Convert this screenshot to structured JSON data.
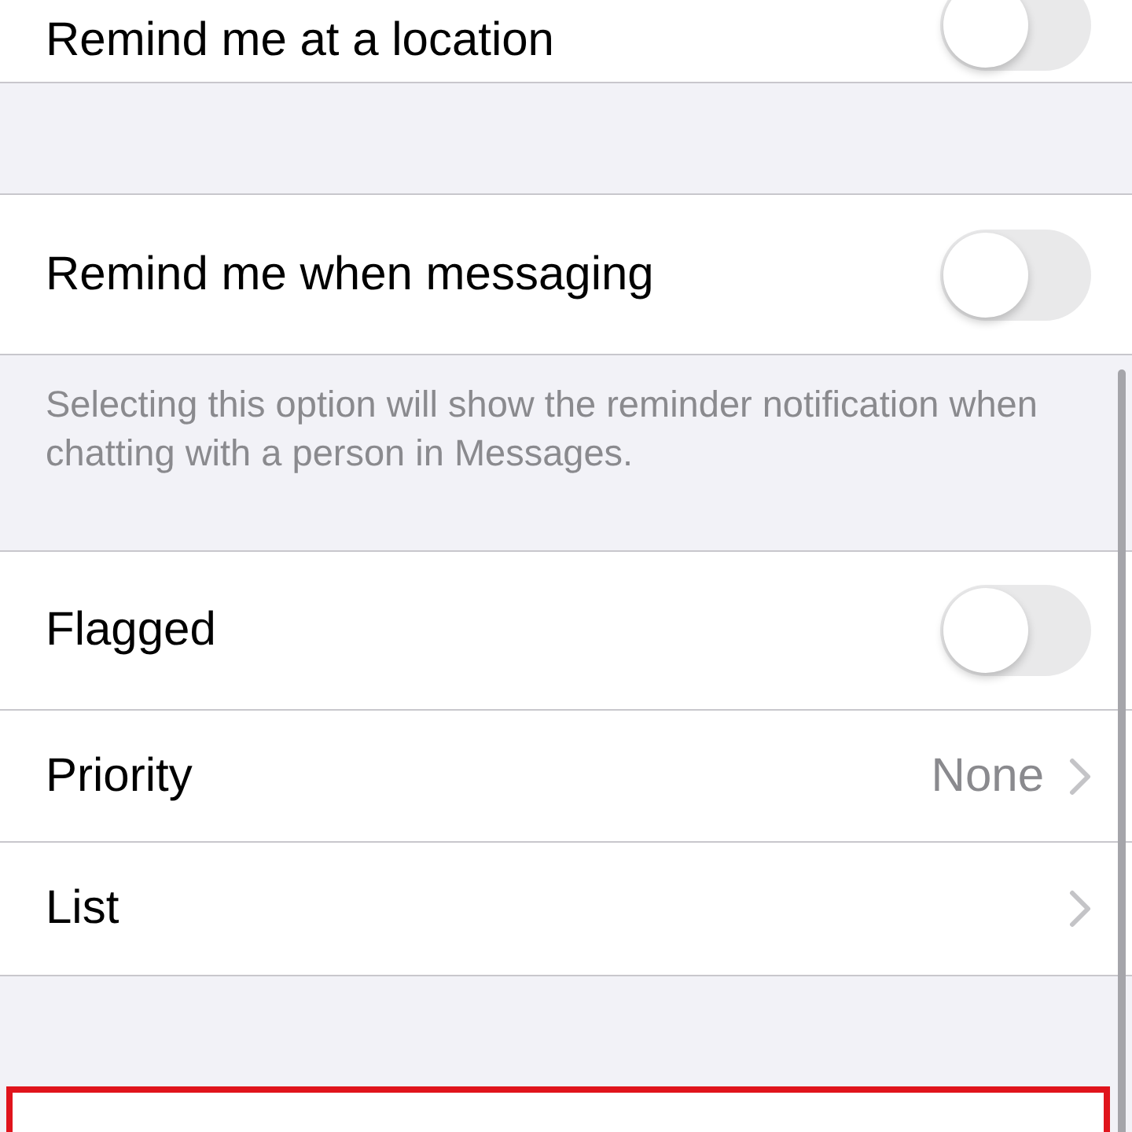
{
  "sections": [
    {
      "rows": [
        {
          "kind": "toggle",
          "label": "Remind me at a location",
          "on": false
        }
      ]
    },
    {
      "rows": [
        {
          "kind": "toggle",
          "label": "Remind me when messaging",
          "on": false
        }
      ],
      "footer": "Selecting this option will show the reminder notification when chatting with a person in Messages."
    },
    {
      "rows": [
        {
          "kind": "toggle",
          "label": "Flagged",
          "on": false
        },
        {
          "kind": "value",
          "label": "Priority",
          "value": "None"
        },
        {
          "kind": "link",
          "label": "List"
        }
      ]
    },
    {
      "rows": [
        {
          "kind": "blank",
          "highlighted": true
        }
      ]
    }
  ]
}
